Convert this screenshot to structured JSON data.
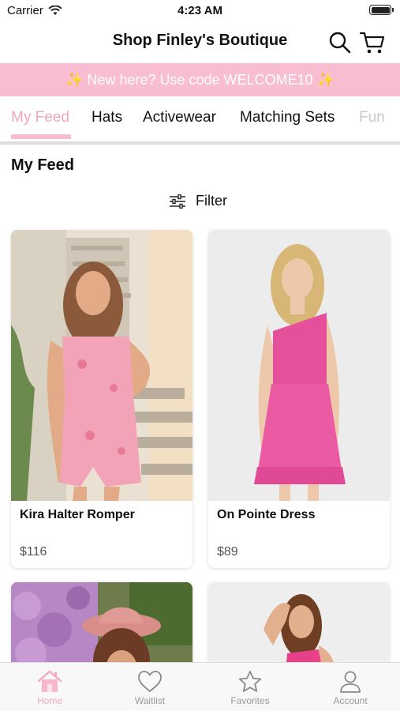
{
  "status_bar": {
    "carrier": "Carrier",
    "time": "4:23 AM"
  },
  "header": {
    "title": "Shop Finley's Boutique"
  },
  "promo": {
    "text": "✨ New here? Use code WELCOME10 ✨"
  },
  "tabs": [
    {
      "label": "My Feed",
      "active": true
    },
    {
      "label": "Hats"
    },
    {
      "label": "Activewear"
    },
    {
      "label": "Matching Sets"
    },
    {
      "label": "Fun"
    }
  ],
  "feed": {
    "title": "My Feed",
    "filter_label": "Filter",
    "products": [
      {
        "name": "Kira Halter Romper",
        "price": "$116"
      },
      {
        "name": "On Pointe Dress",
        "price": "$89"
      },
      {
        "name": "",
        "price": ""
      },
      {
        "name": "",
        "price": ""
      }
    ]
  },
  "bottom_nav": [
    {
      "label": "Home",
      "icon": "home-icon",
      "active": true
    },
    {
      "label": "Waitlist",
      "icon": "heart-icon"
    },
    {
      "label": "Favorites",
      "icon": "star-icon"
    },
    {
      "label": "Account",
      "icon": "user-icon"
    }
  ],
  "colors": {
    "accent": "#f8bdd0",
    "active_tab": "#f2a5bf",
    "inactive": "#9a9a9a"
  }
}
